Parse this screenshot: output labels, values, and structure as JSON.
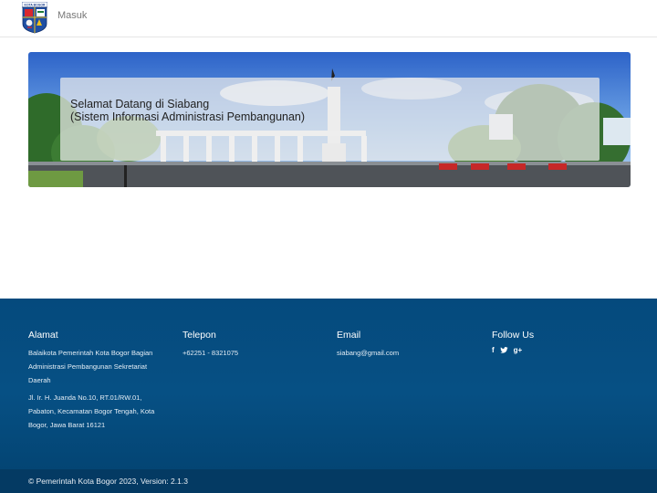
{
  "navbar": {
    "logo_icon": "kota-bogor-crest-icon",
    "logo_text": "KOTA BOGOR",
    "login_label": "Masuk"
  },
  "hero": {
    "title": "Selamat Datang di Siabang",
    "subtitle": "(Sistem Informasi Administrasi Pembangunan)"
  },
  "footer": {
    "address": {
      "heading": "Alamat",
      "line1": "Balaikota Pemerintah Kota Bogor Bagian Administrasi Pembangunan Sekretariat Daerah",
      "line2": "Jl. Ir. H. Juanda No.10, RT.01/RW.01, Pabaton, Kecamatan Bogor Tengah, Kota Bogor, Jawa Barat 16121"
    },
    "phone": {
      "heading": "Telepon",
      "value": "+62251 - 8321075"
    },
    "email": {
      "heading": "Email",
      "value": "siabang@gmail.com"
    },
    "follow": {
      "heading": "Follow Us",
      "facebook_glyph": "f",
      "twitter_icon": "twitter-icon",
      "googleplus_glyph": "g+"
    },
    "copyright": "© Pemerintah Kota Bogor 2023, Version: 2.1.3"
  },
  "colors": {
    "footer_bg": "#065084",
    "bottom_bar_bg": "#043a63"
  }
}
